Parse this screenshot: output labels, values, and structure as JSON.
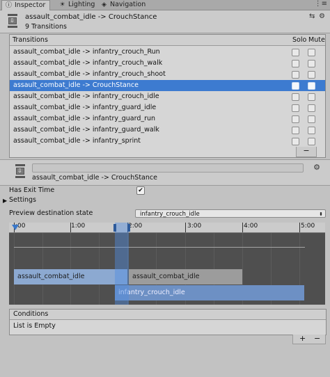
{
  "tabs": [
    {
      "label": "Inspector",
      "icon": "info-icon",
      "active": true
    },
    {
      "label": "Lighting",
      "icon": "lightbulb-icon",
      "active": false
    },
    {
      "label": "Navigation",
      "icon": "compass-icon",
      "active": false
    }
  ],
  "header": {
    "title": "assault_combat_idle -> CrouchStance",
    "subtitle": "9 Transitions"
  },
  "transitions": {
    "header_label": "Transitions",
    "solo_label": "Solo",
    "mute_label": "Mute",
    "selected_index": 4,
    "items": [
      {
        "label": "assault_combat_idle -> infantry_crouch_Run"
      },
      {
        "label": "assault_combat_idle -> infantry_crouch_walk"
      },
      {
        "label": "assault_combat_idle -> infantry_crouch_shoot"
      },
      {
        "label": "assault_combat_idle -> CrouchStance"
      },
      {
        "label": "assault_combat_idle -> infantry_crouch_idle"
      },
      {
        "label": "assault_combat_idle -> infantry_guard_idle"
      },
      {
        "label": "assault_combat_idle -> infantry_guard_run"
      },
      {
        "label": "assault_combat_idle -> infantry_guard_walk"
      },
      {
        "label": "assault_combat_idle -> infantry_sprint"
      }
    ],
    "remove_label": "−"
  },
  "detail": {
    "name_value": "",
    "title": "assault_combat_idle -> CrouchStance"
  },
  "settings": {
    "has_exit_time_label": "Has Exit Time",
    "has_exit_time_checked": true,
    "check_glyph": "✔",
    "settings_label": "Settings",
    "fold_glyph": "▶",
    "preview_label": "Preview destination state",
    "preview_value": "infantry_crouch_idle"
  },
  "timeline": {
    "labels": [
      ":00",
      "1:00",
      "2:00",
      "3:00",
      "4:00",
      "5:00"
    ],
    "clips": {
      "source": "assault_combat_idle",
      "source_after": "assault_combat_idle",
      "destination": "infantry_crouch_idle"
    }
  },
  "conditions": {
    "header_label": "Conditions",
    "empty_text": "List is Empty",
    "add_label": "+",
    "remove_label": "−"
  },
  "colors": {
    "selection": "#3d7bd0",
    "source_clip": "#8ca9d1",
    "destination_clip": "#6d90c4"
  }
}
